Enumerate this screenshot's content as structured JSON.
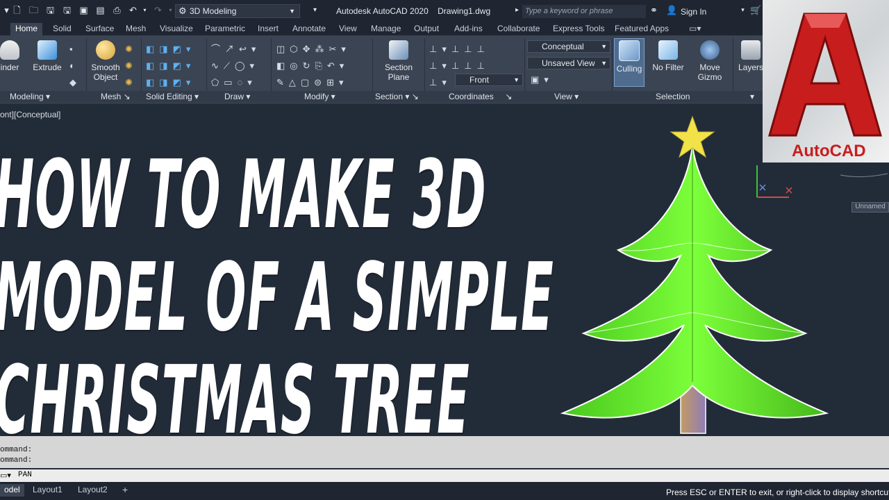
{
  "titlebar": {
    "workspace": "3D Modeling",
    "app_title": "Autodesk AutoCAD 2020",
    "drawing": "Drawing1.dwg",
    "search_placeholder": "Type a keyword or phrase",
    "sign_in": "Sign In"
  },
  "tabs": [
    "Home",
    "Solid",
    "Surface",
    "Mesh",
    "Visualize",
    "Parametric",
    "Insert",
    "Annotate",
    "View",
    "Manage",
    "Output",
    "Add-ins",
    "Collaborate",
    "Express Tools",
    "Featured Apps"
  ],
  "ribbon": {
    "btn_cylinder": "inder",
    "btn_extrude": "Extrude",
    "btn_smooth_1": "Smooth",
    "btn_smooth_2": "Object",
    "btn_section_1": "Section",
    "btn_section_2": "Plane",
    "btn_culling": "Culling",
    "btn_nofilter": "No Filter",
    "btn_move_1": "Move",
    "btn_move_2": "Gizmo",
    "btn_layers": "Layers",
    "visual_style": "Conceptual",
    "saved_view": "Unsaved View",
    "ucs_view": "Front",
    "panels": {
      "modeling": "Modeling",
      "mesh": "Mesh",
      "solid_editing": "Solid Editing",
      "draw": "Draw",
      "modify": "Modify",
      "section": "Section",
      "coordinates": "Coordinates",
      "view": "View",
      "selection": "Selection"
    }
  },
  "viewport": {
    "label": "ont][Conceptual]",
    "unnamed": "Unnamed"
  },
  "headline": {
    "line1": "HOW TO MAKE 3D",
    "line2": "MODEL OF A SIMPLE",
    "line3": "CHRISTMAS TREE"
  },
  "logo_text": "AutoCAD",
  "command": {
    "line1": "ommand:",
    "line2": "ommand:",
    "current": "PAN"
  },
  "layouts": {
    "model": "odel",
    "layout1": "Layout1",
    "layout2": "Layout2"
  },
  "status_message": "Press ESC or ENTER to exit, or right-click to display shortcut-m",
  "colors": {
    "tree_green": "#6ff32a",
    "star": "#f1e24a",
    "trunk": "#a88463",
    "bg": "#222c39"
  }
}
